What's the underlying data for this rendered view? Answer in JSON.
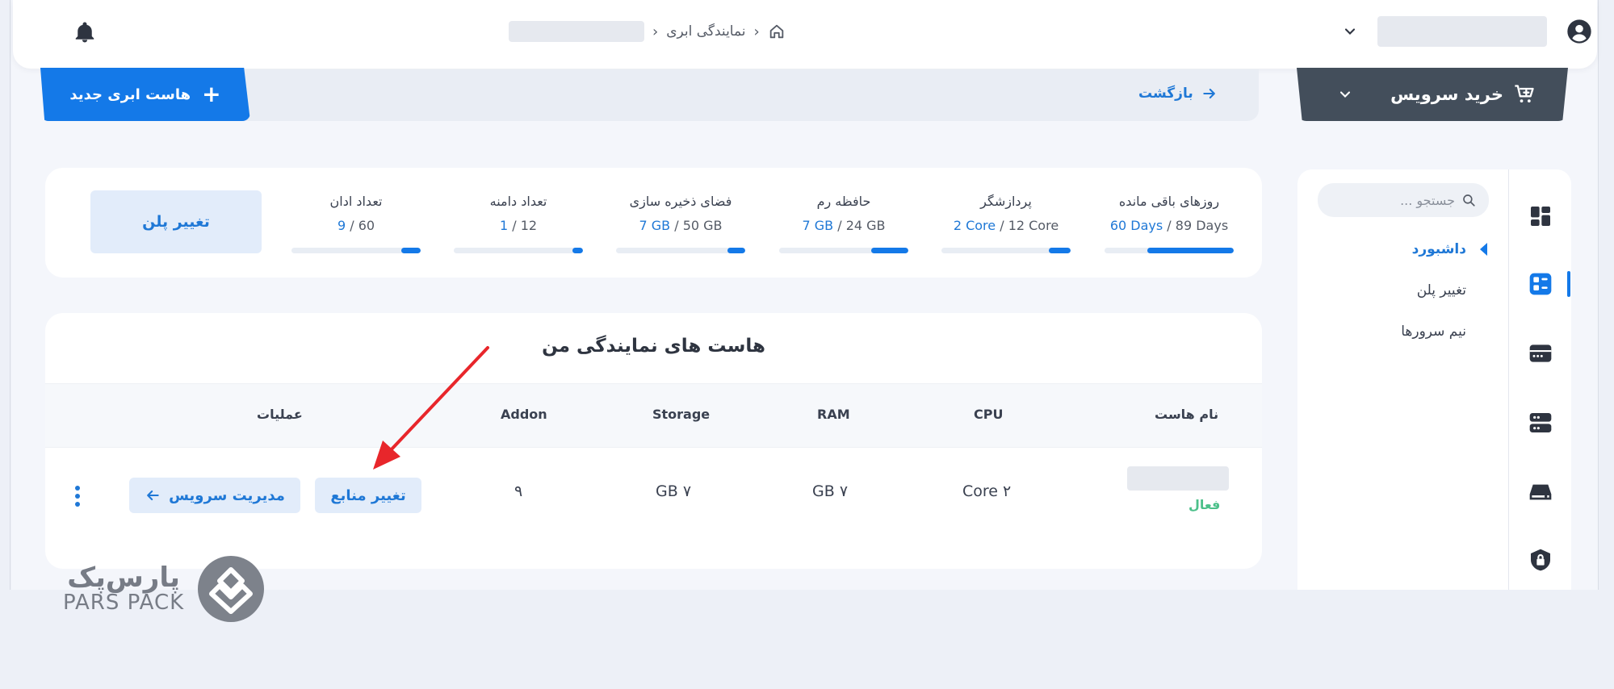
{
  "header": {
    "breadcrumb": {
      "home_icon": "home-icon",
      "section": "نمایندگی ابری",
      "separator": "›"
    },
    "icons": {
      "bell": "bell-icon",
      "user": "user-circle-icon",
      "user_menu": "chevron-down-icon"
    }
  },
  "actions": {
    "new_host_label": "هاست ابری جدید",
    "back_label": "بازگشت",
    "buy_service_label": "خرید سرویس"
  },
  "sidebar": {
    "search_placeholder": "جستجو ...",
    "items": [
      {
        "label": "داشبورد",
        "active": true
      },
      {
        "label": "تغییر پلن",
        "active": false
      },
      {
        "label": "نیم سرورها",
        "active": false
      }
    ],
    "rail_icons": [
      "dashboard-icon",
      "reseller-icon",
      "server-icon",
      "servers-icon",
      "storage-icon",
      "lock-icon"
    ]
  },
  "stats": {
    "change_plan_label": "تغییر پلن",
    "items": [
      {
        "label": "روزهای باقی مانده",
        "used": "60 Days",
        "total": " / 89 Days",
        "fraction": 0.67
      },
      {
        "label": "پردازشگر",
        "used": "2 Core",
        "total": " / 12 Core",
        "fraction": 0.17
      },
      {
        "label": "حافظه رم",
        "used": "7 GB",
        "total": " / 24 GB",
        "fraction": 0.29
      },
      {
        "label": "فضای ذخیره سازی",
        "used": "7 GB",
        "total": " / 50 GB",
        "fraction": 0.14
      },
      {
        "label": "تعداد دامنه",
        "used": "1",
        "total": " / 12",
        "fraction": 0.08
      },
      {
        "label": "تعداد ادان",
        "used": "9",
        "total": " / 60",
        "fraction": 0.15
      }
    ]
  },
  "hosts": {
    "title": "هاست های نمایندگی من",
    "columns": {
      "name": "نام هاست",
      "cpu": "CPU",
      "ram": "RAM",
      "storage": "Storage",
      "addon": "Addon",
      "actions": "عملیات"
    },
    "row": {
      "status": "فعال",
      "cpu": "۲ Core",
      "ram": "۷ GB",
      "storage": "۷ GB",
      "addon": "۹",
      "change_resources_label": "تغییر منابع",
      "manage_service_label": "مدیریت سرویس"
    }
  },
  "logo": {
    "fa": "پارس‌پک",
    "en": "PARS PACK"
  },
  "colors": {
    "accent": "#1479e8",
    "dark_button": "#434e5b",
    "status_active": "#4cc08a",
    "annotation_arrow": "#e8262b"
  }
}
